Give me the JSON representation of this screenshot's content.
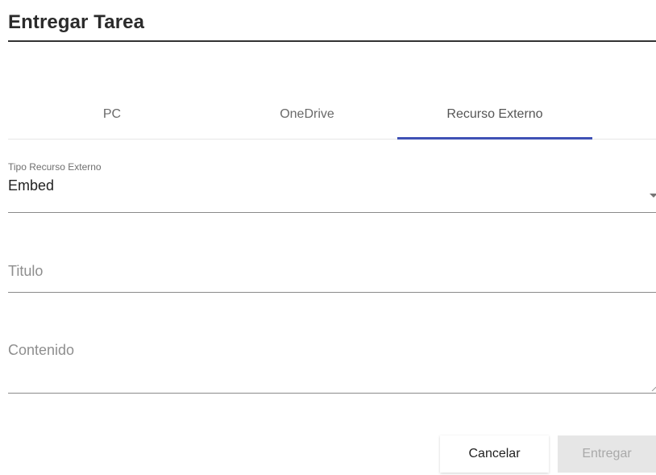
{
  "dialog": {
    "title": "Entregar Tarea"
  },
  "tabs": [
    {
      "label": "PC",
      "active": false
    },
    {
      "label": "OneDrive",
      "active": false
    },
    {
      "label": "Recurso Externo",
      "active": true
    }
  ],
  "accent_color": "#3f51b5",
  "form": {
    "resource_type": {
      "label": "Tipo Recurso Externo",
      "value": "Embed"
    },
    "title_field": {
      "placeholder": "Titulo"
    },
    "content_field": {
      "placeholder": "Contenido"
    }
  },
  "actions": {
    "cancel_label": "Cancelar",
    "submit_label": "Entregar",
    "submit_disabled": true
  }
}
